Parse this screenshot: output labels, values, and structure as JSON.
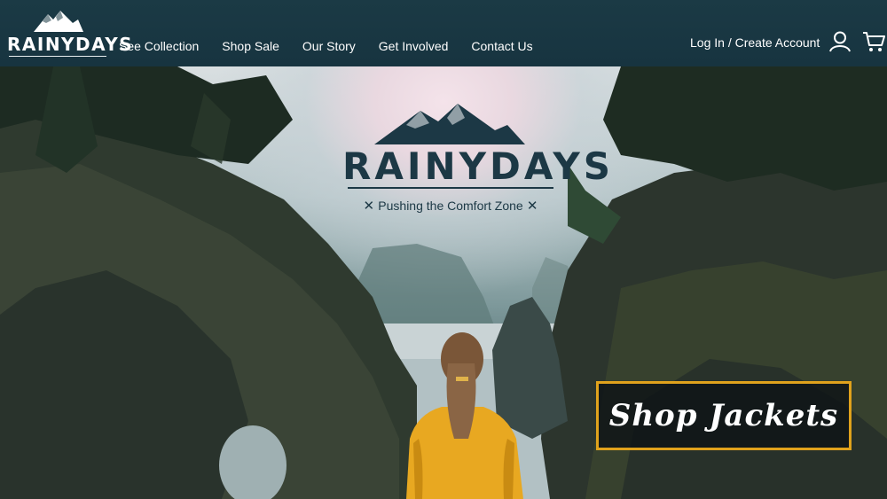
{
  "brand": {
    "name": "RAINYDAYS"
  },
  "nav": {
    "links": [
      {
        "label": "See Collection"
      },
      {
        "label": "Shop Sale"
      },
      {
        "label": "Our Story"
      },
      {
        "label": "Get Involved"
      },
      {
        "label": "Contact Us"
      }
    ],
    "account_label": "Log In / Create Account",
    "icons": [
      "user-icon",
      "cart-icon"
    ]
  },
  "hero": {
    "title": "RAINYDAYS",
    "tagline": "Pushing the Comfort Zone",
    "cta_label": "Shop Jackets",
    "icons": [
      "mountain-logo-icon"
    ]
  },
  "colors": {
    "nav_bg": "#1b3a45",
    "logo_text": "#1c3845",
    "cta_border": "#e0a21c",
    "jacket": "#e8a821"
  }
}
